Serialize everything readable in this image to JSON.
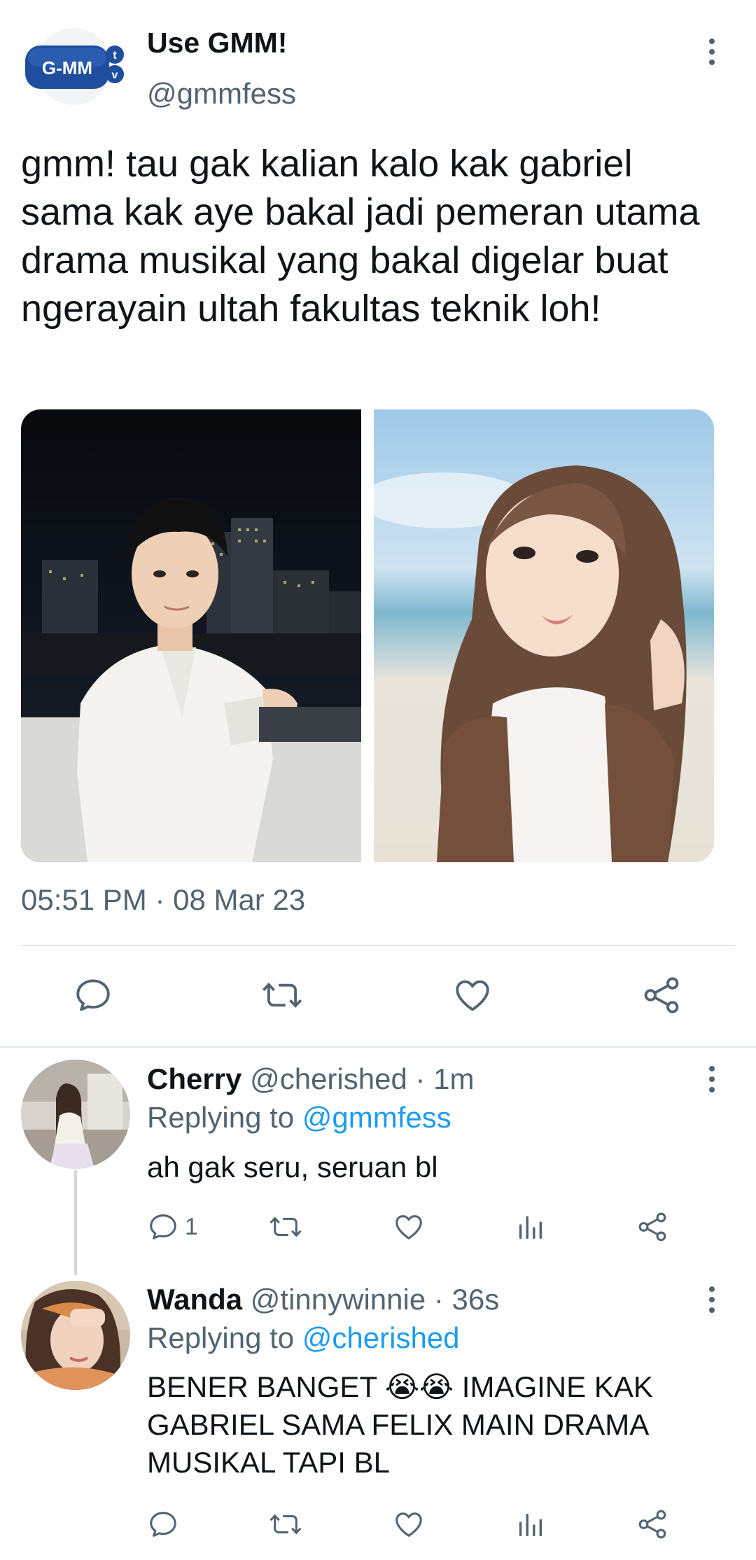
{
  "tweet": {
    "author_name": "Use GMM!",
    "author_handle": "@gmmfess",
    "logo_text": "G-MM",
    "logo_badge": "tv",
    "text": "gmm! tau gak kalian kalo kak gabriel sama kak aye bakal jadi pemeran utama drama musikal yang bakal digelar buat ngerayain ultah fakultas teknik loh!",
    "timestamp": "05:51 PM · 08 Mar 23"
  },
  "replies": [
    {
      "name": "Cherry",
      "meta": " @cherished · 1m",
      "replying_prefix": "Replying to ",
      "replying_to": "@gmmfess",
      "text": "ah gak seru, seruan bl",
      "reply_count": "1"
    },
    {
      "name": "Wanda",
      "meta": " @tinnywinnie · 36s",
      "replying_prefix": "Replying to ",
      "replying_to": "@cherished",
      "text": "BENER BANGET 😭😭 IMAGINE KAK GABRIEL SAMA FELIX MAIN DRAMA MUSIKAL TAPI BL",
      "reply_count": ""
    }
  ],
  "icons": {
    "reply": "reply-icon",
    "retweet": "retweet-icon",
    "like": "heart-icon",
    "share": "share-icon",
    "views": "analytics-icon",
    "more": "more-vertical-icon"
  },
  "colors": {
    "text": "#0f1419",
    "secondary": "#536471",
    "link": "#1d9bf0",
    "logo_blue": "#1f4e9e"
  }
}
